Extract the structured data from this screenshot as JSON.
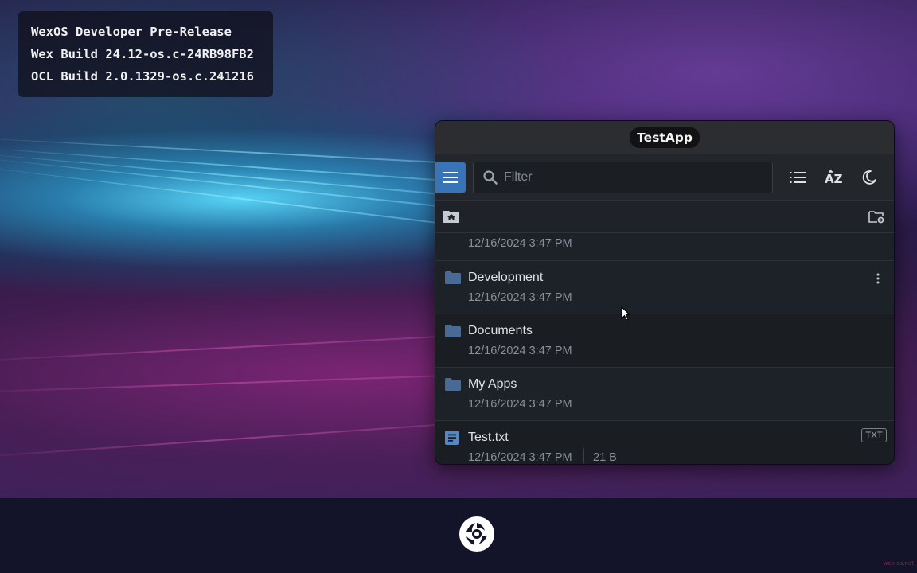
{
  "desktop": {
    "build_info": {
      "line1": "WexOS Developer Pre-Release",
      "line2": "Wex Build 24.12-os.c-24RB98FB2",
      "line3": "OCL Build 2.0.1329-os.c.241216"
    },
    "watermark": "wex-os.net"
  },
  "window": {
    "title": "TestApp",
    "toolbar": {
      "menu_icon": "hamburger-icon",
      "filter_placeholder": "Filter",
      "filter_value": "",
      "view_icon": "list-view-icon",
      "sort_icon": "sort-az-icon",
      "theme_icon": "moon-icon"
    },
    "pathbar": {
      "home_icon": "folder-home-icon",
      "settings_icon": "folder-settings-icon"
    },
    "files": [
      {
        "name": "",
        "date": "12/16/2024 3:47 PM",
        "type": "folder",
        "partial": true
      },
      {
        "name": "Development",
        "date": "12/16/2024 3:47 PM",
        "type": "folder"
      },
      {
        "name": "Documents",
        "date": "12/16/2024 3:47 PM",
        "type": "folder"
      },
      {
        "name": "My Apps",
        "date": "12/16/2024 3:47 PM",
        "type": "folder"
      },
      {
        "name": "Test.txt",
        "date": "12/16/2024 3:47 PM",
        "size": "21 B",
        "ext": "TXT",
        "type": "file"
      }
    ]
  },
  "colors": {
    "accent": "#3a74b8",
    "folder": "#4a6a96",
    "window_bg": "#1d2228"
  }
}
